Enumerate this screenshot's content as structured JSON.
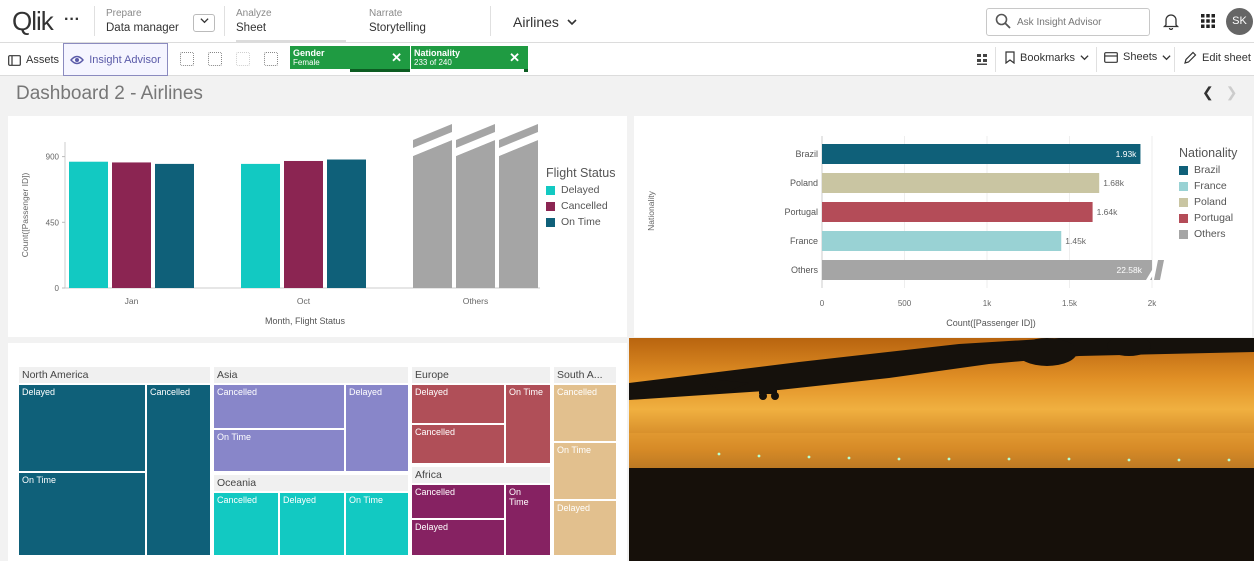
{
  "topbar": {
    "logo": "Qlik",
    "more": "···",
    "prepare": {
      "small": "Prepare",
      "main": "Data manager"
    },
    "analyze": {
      "small": "Analyze",
      "main": "Sheet"
    },
    "narrate": {
      "small": "Narrate",
      "main": "Storytelling"
    },
    "app_name": "Airlines",
    "ask_placeholder": "Ask Insight Advisor",
    "avatar_initials": "SK"
  },
  "toolbar": {
    "assets": "Assets",
    "insight_advisor": "Insight Advisor",
    "chips": [
      {
        "name": "Gender",
        "value": "Female",
        "fill": 0.5
      },
      {
        "name": "Nationality",
        "value": "233 of 240",
        "fill": 0.97
      }
    ],
    "bookmarks": "Bookmarks",
    "sheets": "Sheets",
    "edit_sheet": "Edit sheet"
  },
  "sheet": {
    "title": "Dashboard 2 - Airlines"
  },
  "colors": {
    "teal": "#12c9c2",
    "maroon": "#8b2552",
    "dark_blue": "#0f6079",
    "gray": "#a5a5a5",
    "brazil": "#0f6079",
    "poland": "#c9c5a2",
    "portugal": "#b44c58",
    "france": "#99d2d4",
    "others": "#a5a5a5",
    "north_america": "#0f6079",
    "asia": "#8886c9",
    "oceania": "#12c9c2",
    "europe": "#b04f58",
    "africa": "#862262",
    "south_america": "#e2c08e"
  },
  "chart_data": [
    {
      "type": "bar",
      "xlabel": "Month, Flight Status",
      "ylabel": "Count([Passenger ID])",
      "ylim": [
        0,
        1000
      ],
      "yticks": [
        "0",
        "450",
        "900"
      ],
      "categories": [
        "Jan",
        "Oct",
        "Others"
      ],
      "series": [
        {
          "name": "Delayed",
          "values": [
            865,
            850,
            null
          ]
        },
        {
          "name": "Cancelled",
          "values": [
            860,
            870,
            null
          ]
        },
        {
          "name": "On Time",
          "values": [
            850,
            880,
            null
          ]
        }
      ],
      "others_truncated": true,
      "legend": {
        "title": "Flight Status",
        "items": [
          "Delayed",
          "Cancelled",
          "On Time"
        ],
        "position": "right"
      }
    },
    {
      "type": "bar",
      "orientation": "horizontal",
      "ylabel": "Nationality",
      "xlabel": "Count([Passenger ID])",
      "xlim": [
        0,
        2000
      ],
      "xticks": [
        "0",
        "500",
        "1k",
        "1.5k",
        "2k"
      ],
      "categories": [
        "Brazil",
        "Poland",
        "Portugal",
        "France",
        "Others"
      ],
      "values": [
        1930,
        1680,
        1640,
        1450,
        22580
      ],
      "labels": [
        "1.93k",
        "1.68k",
        "1.64k",
        "1.45k",
        "22.58k"
      ],
      "legend": {
        "title": "Nationality",
        "items": [
          "Brazil",
          "France",
          "Poland",
          "Portugal",
          "Others"
        ],
        "position": "right"
      }
    }
  ],
  "treemap": {
    "north_america": {
      "label": "North America",
      "cells": [
        "Delayed",
        "Cancelled",
        "On Time"
      ]
    },
    "asia": {
      "label": "Asia",
      "cells": [
        "Cancelled",
        "Delayed",
        "On Time"
      ]
    },
    "oceania": {
      "label": "Oceania",
      "cells": [
        "Cancelled",
        "Delayed",
        "On Time"
      ]
    },
    "europe": {
      "label": "Europe",
      "cells": [
        "Delayed",
        "On Time",
        "Cancelled"
      ]
    },
    "africa": {
      "label": "Africa",
      "cells": [
        "Cancelled",
        "On\nTime",
        "Delayed"
      ]
    },
    "south_america": {
      "label": "South A...",
      "cells": [
        "Cancelled",
        "On Time",
        "Delayed"
      ]
    }
  }
}
